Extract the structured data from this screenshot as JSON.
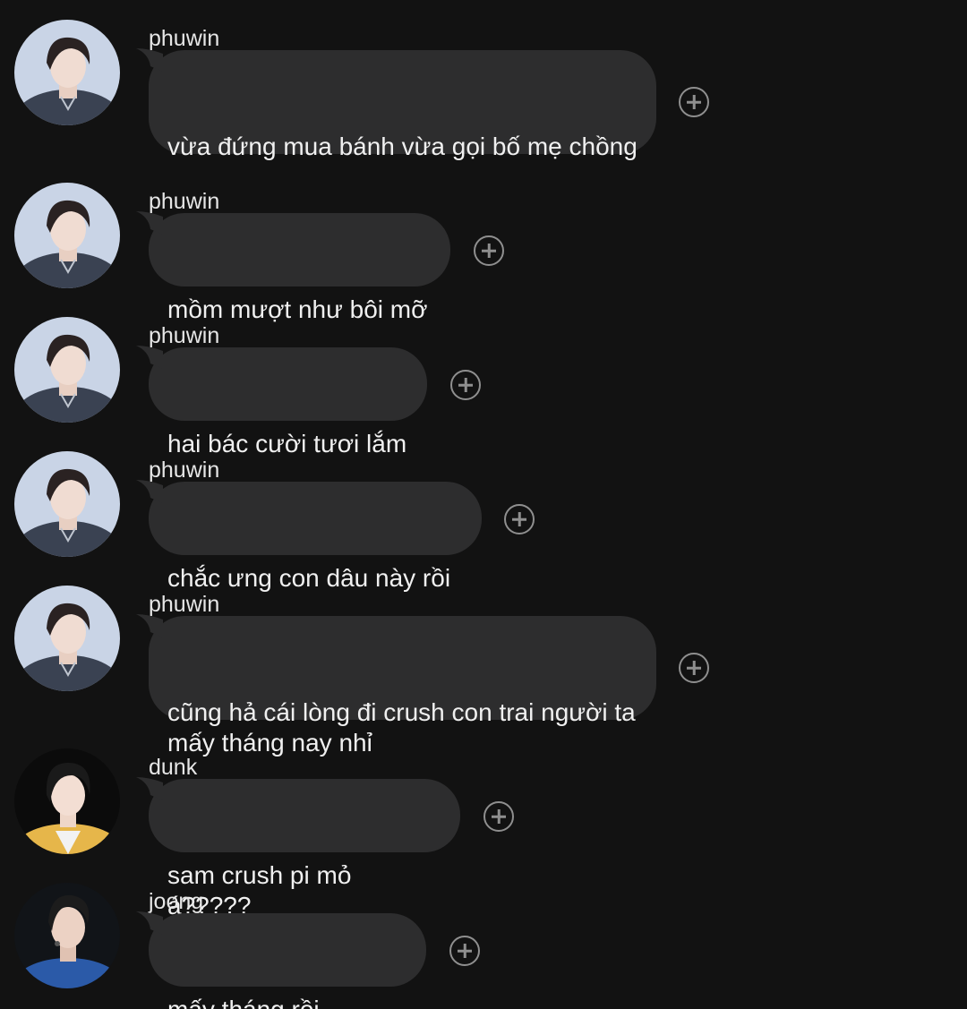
{
  "messages": [
    {
      "sender": "phuwin",
      "avatar": "avatar-phuwin",
      "text": "vừa đứng mua bánh vừa gọi bố mẹ chồng"
    },
    {
      "sender": "phuwin",
      "avatar": "avatar-phuwin",
      "text": "mồm mượt như bôi mỡ"
    },
    {
      "sender": "phuwin",
      "avatar": "avatar-phuwin",
      "text": "hai bác cười tươi lắm"
    },
    {
      "sender": "phuwin",
      "avatar": "avatar-phuwin",
      "text": "chắc ưng con dâu này rồi"
    },
    {
      "sender": "phuwin",
      "avatar": "avatar-phuwin",
      "text": "cũng hả cái lòng đi crush con trai người ta mấy tháng nay nhỉ"
    },
    {
      "sender": "dunk",
      "avatar": "avatar-dunk",
      "text": "sam crush pi mỏ á?????"
    },
    {
      "sender": "joong",
      "avatar": "avatar-joong",
      "text": "mấy tháng rồi á?????"
    }
  ],
  "colors": {
    "background": "#121212",
    "bubble": "#2d2d2e",
    "text": "#f0f0f0",
    "name": "#e6e6e6",
    "react_icon": "#8f8f8f"
  },
  "icons": {
    "react": "add-reaction-icon"
  }
}
